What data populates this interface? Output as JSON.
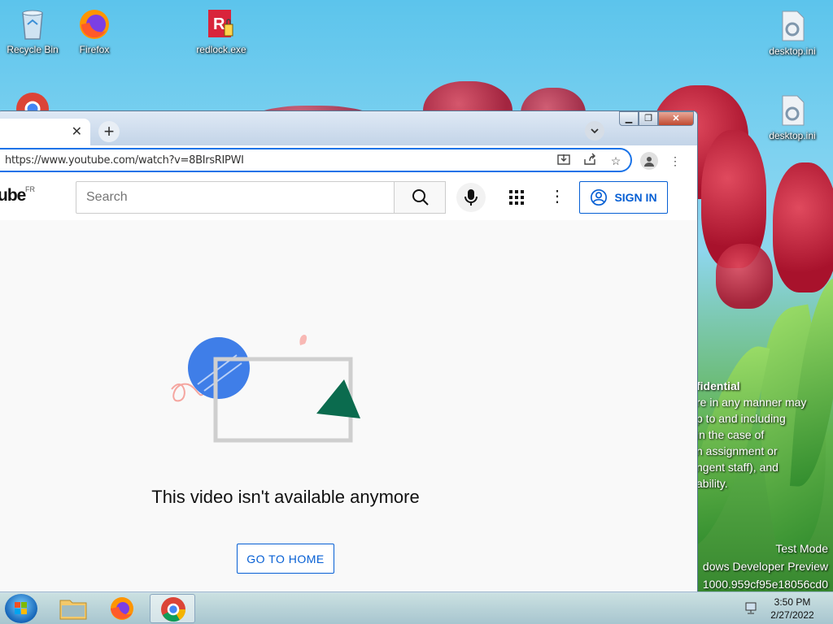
{
  "desktop": {
    "icons": [
      {
        "label": "Recycle Bin",
        "icon": "recycle-bin-icon"
      },
      {
        "label": "Firefox",
        "icon": "firefox-icon"
      },
      {
        "label": "redlock.exe",
        "icon": "redlock-icon"
      },
      {
        "label": "desktop.ini",
        "icon": "settings-file-icon"
      },
      {
        "label": "desktop.ini",
        "icon": "settings-file-icon"
      }
    ],
    "legal_lines": [
      "fidential",
      "re in any manner may",
      "p to and including",
      "in the case of",
      "n assignment or",
      "ngent staff), and",
      "ability."
    ],
    "watermark_lines": [
      "Test Mode",
      "dows Developer Preview",
      "1000.959cf95e18056cd0"
    ]
  },
  "browser": {
    "new_tab_symbol": "+",
    "tab_close_symbol": "✕",
    "url": "https://www.youtube.com/watch?v=8BIrsRIPWI",
    "window_buttons": [
      "minimize",
      "restore",
      "close"
    ]
  },
  "youtube": {
    "logo_text": "ube",
    "region": "FR",
    "search_placeholder": "Search",
    "signin_label": "SIGN IN",
    "message": "This video isn't available anymore",
    "home_button": "GO TO HOME"
  },
  "taskbar": {
    "apps": [
      "windows-explorer",
      "firefox",
      "chrome"
    ],
    "active_app": "chrome",
    "time": "3:50 PM",
    "date": "2/27/2022"
  },
  "colors": {
    "yt_blue": "#065fd4",
    "focus_blue": "#1a73e8"
  }
}
